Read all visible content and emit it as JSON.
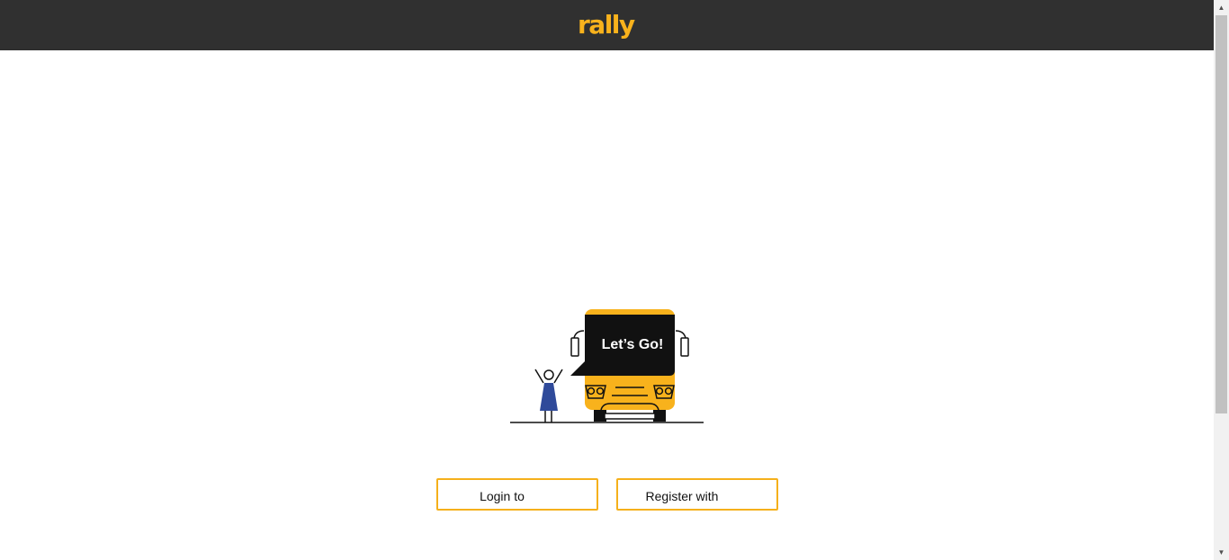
{
  "header": {
    "logo_text": "rally",
    "background_color": "#303030",
    "logo_color": "#f8b21c"
  },
  "illustration": {
    "speech_text": "Let’s Go!",
    "bus_color": "#f8b21c",
    "person_dress_color": "#2f4a9a"
  },
  "actions": {
    "login_label": "Login to",
    "register_label": "Register with",
    "border_color": "#f5b01b"
  },
  "scrollbar": {
    "up_icon": "scroll-up-arrow-icon",
    "down_icon": "scroll-down-arrow-icon"
  }
}
